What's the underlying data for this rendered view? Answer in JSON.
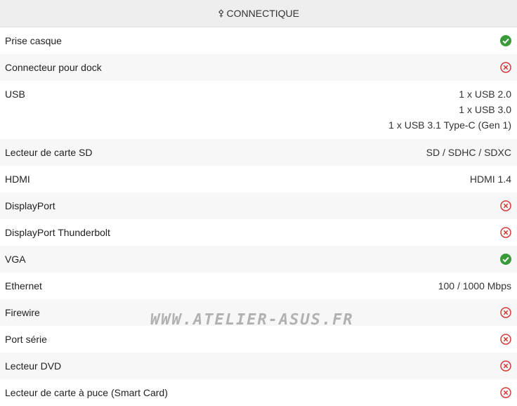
{
  "header": {
    "icon": "usb-icon",
    "title": "CONNECTIQUE"
  },
  "colors": {
    "yes": "#3a9a3a",
    "no": "#d43a3a"
  },
  "rows": [
    {
      "label": "Prise casque",
      "status": "yes"
    },
    {
      "label": "Connecteur pour dock",
      "status": "no"
    },
    {
      "label": "USB",
      "values": [
        "1 x USB 2.0",
        "1 x USB 3.0",
        "1 x USB 3.1 Type-C (Gen 1)"
      ]
    },
    {
      "label": "Lecteur de carte SD",
      "value": "SD / SDHC / SDXC"
    },
    {
      "label": "HDMI",
      "value": "HDMI 1.4"
    },
    {
      "label": "DisplayPort",
      "status": "no"
    },
    {
      "label": "DisplayPort Thunderbolt",
      "status": "no"
    },
    {
      "label": "VGA",
      "status": "yes"
    },
    {
      "label": "Ethernet",
      "value": "100 / 1000 Mbps"
    },
    {
      "label": "Firewire",
      "status": "no"
    },
    {
      "label": "Port série",
      "status": "no"
    },
    {
      "label": "Lecteur DVD",
      "status": "no"
    },
    {
      "label": "Lecteur de carte à puce (Smart Card)",
      "status": "no"
    }
  ],
  "watermark": "WWW.ATELIER-ASUS.FR"
}
